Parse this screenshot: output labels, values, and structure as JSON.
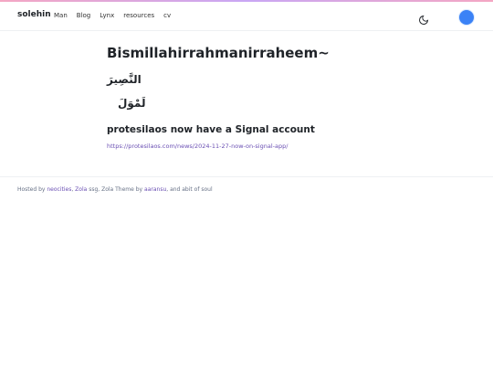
{
  "header": {
    "brand": "solehin",
    "nav": [
      "Man",
      "Blog",
      "Lynx",
      "resources",
      "cv"
    ]
  },
  "icons": {
    "theme": "moon-icon",
    "avatar": "avatar"
  },
  "main": {
    "title": "Bismillahirrahmanirraheem~",
    "arabic_1": "النَّصِيرَ",
    "arabic_2": "لَمْوَلَ",
    "post_title": "protesilaos now have a Signal account",
    "post_link": "https://protesilaos.com/news/2024-11-27-now-on-signal-app/"
  },
  "footer": {
    "prefix": "Hosted by",
    "neocities": "neocities",
    "comma1": ",",
    "zola": "Zola",
    "middle": "ssg, Zola Theme by",
    "aaransu": "aaransu",
    "suffix": ", and abit of soul"
  },
  "colors": {
    "accent": "#6a4fb3",
    "avatar": "#3b82f6"
  }
}
